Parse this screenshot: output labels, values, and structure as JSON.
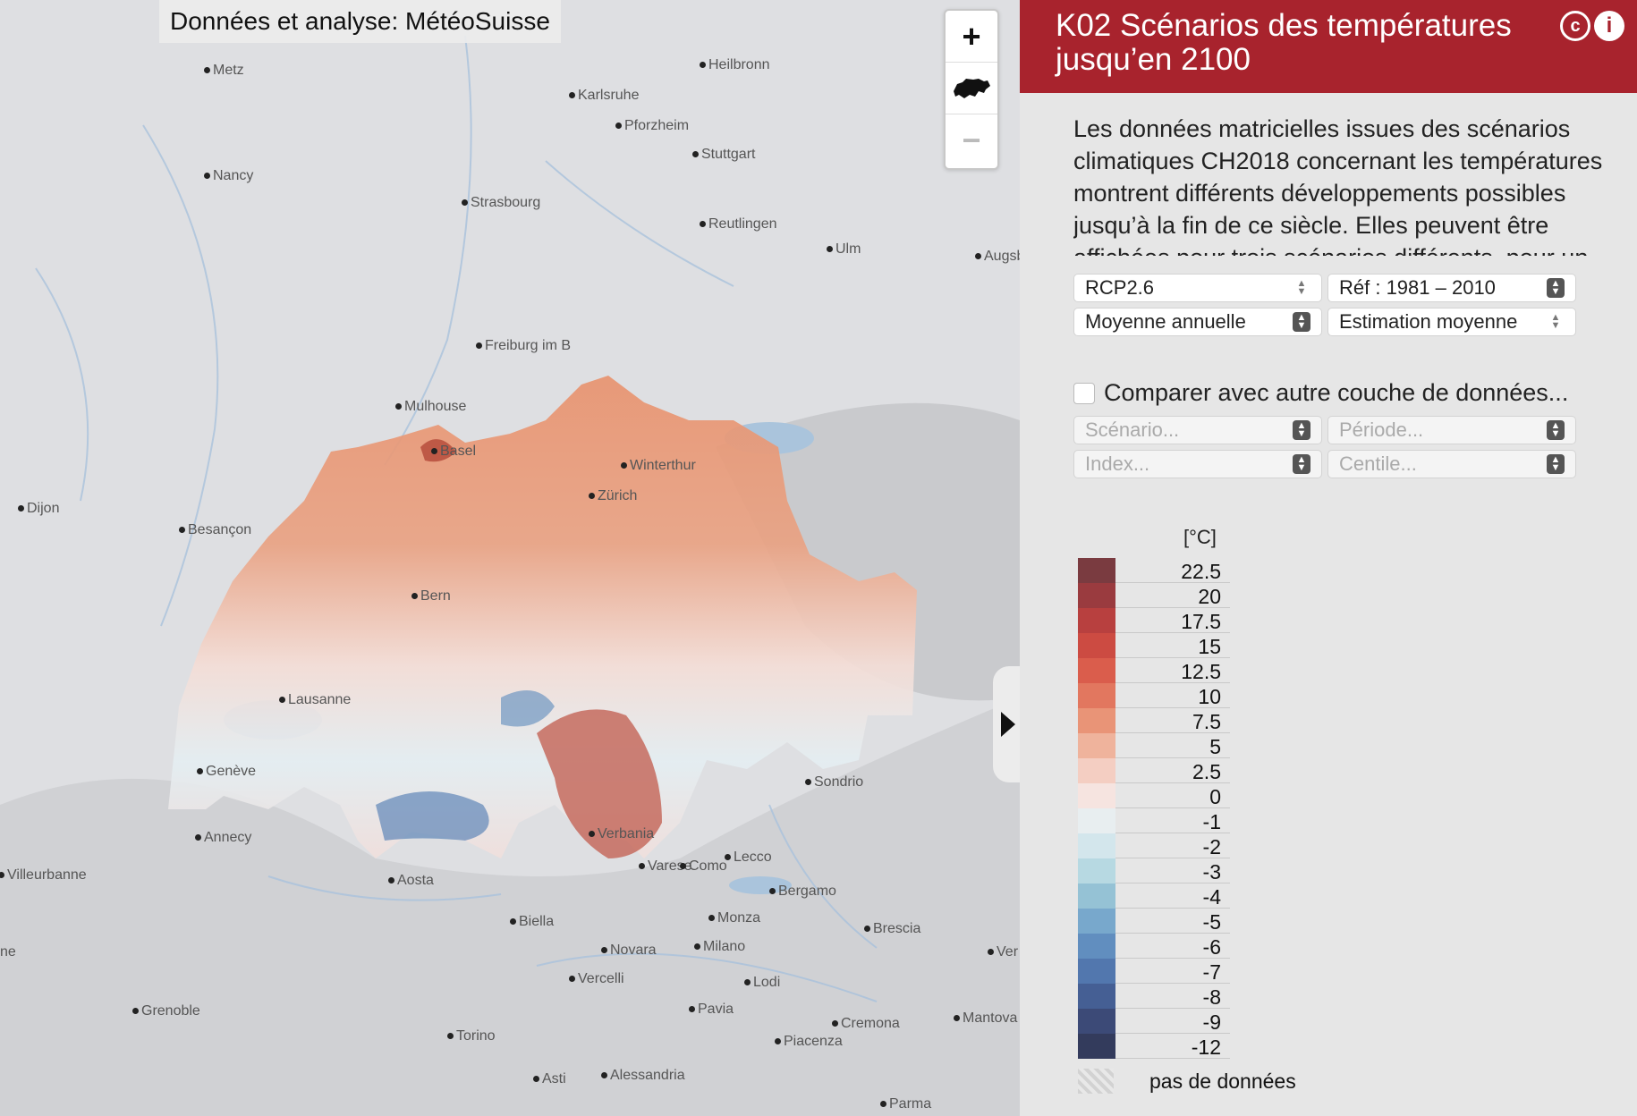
{
  "map": {
    "attribution": "Données et analyse: MétéoSuisse",
    "zoom_in": "+",
    "zoom_out": "−",
    "home_icon": "switzerland-icon",
    "cities": [
      {
        "name": "Metz"
      },
      {
        "name": "Heilbronn"
      },
      {
        "name": "Karlsruhe"
      },
      {
        "name": "Pforzheim"
      },
      {
        "name": "Stuttgart"
      },
      {
        "name": "Nancy"
      },
      {
        "name": "Strasbourg"
      },
      {
        "name": "Reutlingen"
      },
      {
        "name": "Ulm"
      },
      {
        "name": "Augsb"
      },
      {
        "name": "Freiburg im B"
      },
      {
        "name": "Mulhouse"
      },
      {
        "name": "Basel"
      },
      {
        "name": "Winterthur"
      },
      {
        "name": "Zürich"
      },
      {
        "name": "Dijon"
      },
      {
        "name": "Besançon"
      },
      {
        "name": "Bern"
      },
      {
        "name": "Lausanne"
      },
      {
        "name": "Genève"
      },
      {
        "name": "Annecy"
      },
      {
        "name": "Villeurbanne"
      },
      {
        "name": "Aosta"
      },
      {
        "name": "Verbania"
      },
      {
        "name": "Lecco"
      },
      {
        "name": "Varese"
      },
      {
        "name": "Como"
      },
      {
        "name": "Sondrio"
      },
      {
        "name": "Bergamo"
      },
      {
        "name": "Biella"
      },
      {
        "name": "Monza"
      },
      {
        "name": "Brescia"
      },
      {
        "name": "Novara"
      },
      {
        "name": "Milano"
      },
      {
        "name": "Ver"
      },
      {
        "name": "Vercelli"
      },
      {
        "name": "Lodi"
      },
      {
        "name": "Grenoble"
      },
      {
        "name": "Pavia"
      },
      {
        "name": "Cremona"
      },
      {
        "name": "Mantova"
      },
      {
        "name": "Torino"
      },
      {
        "name": "Piacenza"
      },
      {
        "name": "Asti"
      },
      {
        "name": "Alessandria"
      },
      {
        "name": "Parma"
      },
      {
        "name": "ne"
      }
    ]
  },
  "panel": {
    "title": "K02 Scénarios des températures jusqu’en 2100",
    "license_icon": "cc-icon",
    "info_icon": "info-icon",
    "description": "Les données matricielles issues des scénarios climatiques CH2018 concernant les températures montrent différents développements possibles jusqu’à la fin de ce siècle. Elles peuvent être affichées pour trois scénarios différents, pour un",
    "selects": {
      "scenario": "RCP2.6",
      "reference": "Réf : 1981 – 2010",
      "index": "Moyenne annuelle",
      "estimate": "Estimation moyenne"
    },
    "compare_label": "Comparer avec autre couche de données...",
    "compare_selects": {
      "scenario": "Scénario...",
      "period": "Période...",
      "index": "Index...",
      "centile": "Centile..."
    }
  },
  "legend": {
    "unit": "[°C]",
    "entries": [
      {
        "label": "22.5",
        "color": "#7a3b40"
      },
      {
        "label": "20",
        "color": "#9a3b3f"
      },
      {
        "label": "17.5",
        "color": "#b8403f"
      },
      {
        "label": "15",
        "color": "#cc4b42"
      },
      {
        "label": "12.5",
        "color": "#da5d4c"
      },
      {
        "label": "10",
        "color": "#e2775f"
      },
      {
        "label": "7.5",
        "color": "#e99477"
      },
      {
        "label": "5",
        "color": "#efb39c"
      },
      {
        "label": "2.5",
        "color": "#f4cec2"
      },
      {
        "label": "0",
        "color": "#f6e4e0"
      },
      {
        "label": "-1",
        "color": "#e8eef0"
      },
      {
        "label": "-2",
        "color": "#d3e6ec"
      },
      {
        "label": "-3",
        "color": "#b7d9e2"
      },
      {
        "label": "-4",
        "color": "#95c2d5"
      },
      {
        "label": "-5",
        "color": "#78a8cc"
      },
      {
        "label": "-6",
        "color": "#618ebf"
      },
      {
        "label": "-7",
        "color": "#5277ae"
      },
      {
        "label": "-8",
        "color": "#455f94"
      },
      {
        "label": "-9",
        "color": "#3c4a77"
      },
      {
        "label": "-12",
        "color": "#333b5c"
      }
    ],
    "no_data": "pas de données"
  }
}
